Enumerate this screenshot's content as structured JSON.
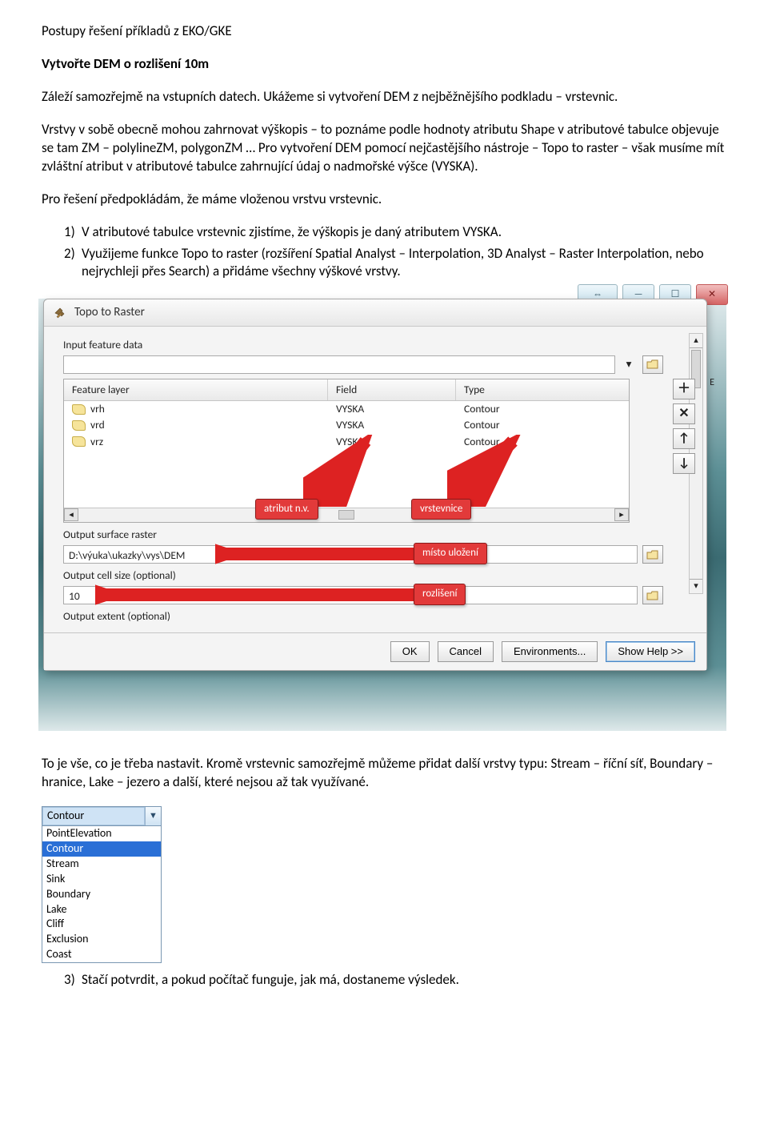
{
  "doc": {
    "title": "Postupy řešení příkladů z EKO/GKE",
    "subtitle": "Vytvořte DEM o rozlišení 10m",
    "p1": "Záleží samozřejmě na vstupních datech. Ukážeme si vytvoření DEM z nejběžnějšího podkladu – vrstevnic.",
    "p2": "Vrstvy v sobě obecně mohou zahrnovat výškopis – to poznáme podle hodnoty atributu Shape v atributové tabulce objevuje se tam ZM – polylineZM, polygonZM … Pro vytvoření DEM pomocí nejčastějšího nástroje – Topo to raster – však musíme mít zvláštní atribut v atributové tabulce zahrnující údaj o nadmořské výšce (VYSKA).",
    "p3": "Pro řešení předpokládám, že máme vloženou vrstvu vrstevnic.",
    "li1_num": "1)",
    "li1": "V atributové tabulce vrstevnic zjistíme, že výškopis je daný atributem VYSKA.",
    "li2_num": "2)",
    "li2": "Využijeme funkce Topo to raster (rozšíření Spatial Analyst – Interpolation, 3D Analyst – Raster Interpolation, nebo nejrychleji přes Search) a přidáme všechny výškové vrstvy.",
    "p_after": "To je vše, co je třeba nastavit. Kromě vrstevnic samozřejmě můžeme přidat další vrstvy typu: Stream – říční síť, Boundary – hranice, Lake – jezero a další, které nejsou až tak využívané.",
    "li3_num": "3)",
    "li3": "Stačí potvrdit, a pokud počítač funguje, jak má, dostaneme výsledek."
  },
  "dialog": {
    "title": "Topo to Raster",
    "lbl_input": "Input feature data",
    "cols": {
      "layer": "Feature layer",
      "field": "Field",
      "type": "Type"
    },
    "rows": [
      {
        "layer": "vrh",
        "field": "VYSKA",
        "type": "Contour"
      },
      {
        "layer": "vrd",
        "field": "VYSKA",
        "type": "Contour"
      },
      {
        "layer": "vrz",
        "field": "VYSKA",
        "type": "Contour"
      }
    ],
    "lbl_out_raster": "Output surface raster",
    "out_raster": "D:\\výuka\\ukazky\\vys\\DEM",
    "lbl_cellsize": "Output cell size (optional)",
    "cellsize": "10",
    "lbl_extent": "Output extent (optional)",
    "btn_ok": "OK",
    "btn_cancel": "Cancel",
    "btn_env": "Environments...",
    "btn_help": "Show Help >>",
    "scroll_side_top": "▲",
    "side_e_label": "E"
  },
  "callouts": {
    "attr": "atribut n.v.",
    "vrst": "vrstevnice",
    "misto": "místo uložení",
    "rozl": "rozlišení"
  },
  "dropdown": {
    "selected": "Contour",
    "options": [
      "PointElevation",
      "Contour",
      "Stream",
      "Sink",
      "Boundary",
      "Lake",
      "Cliff",
      "Exclusion",
      "Coast"
    ]
  }
}
